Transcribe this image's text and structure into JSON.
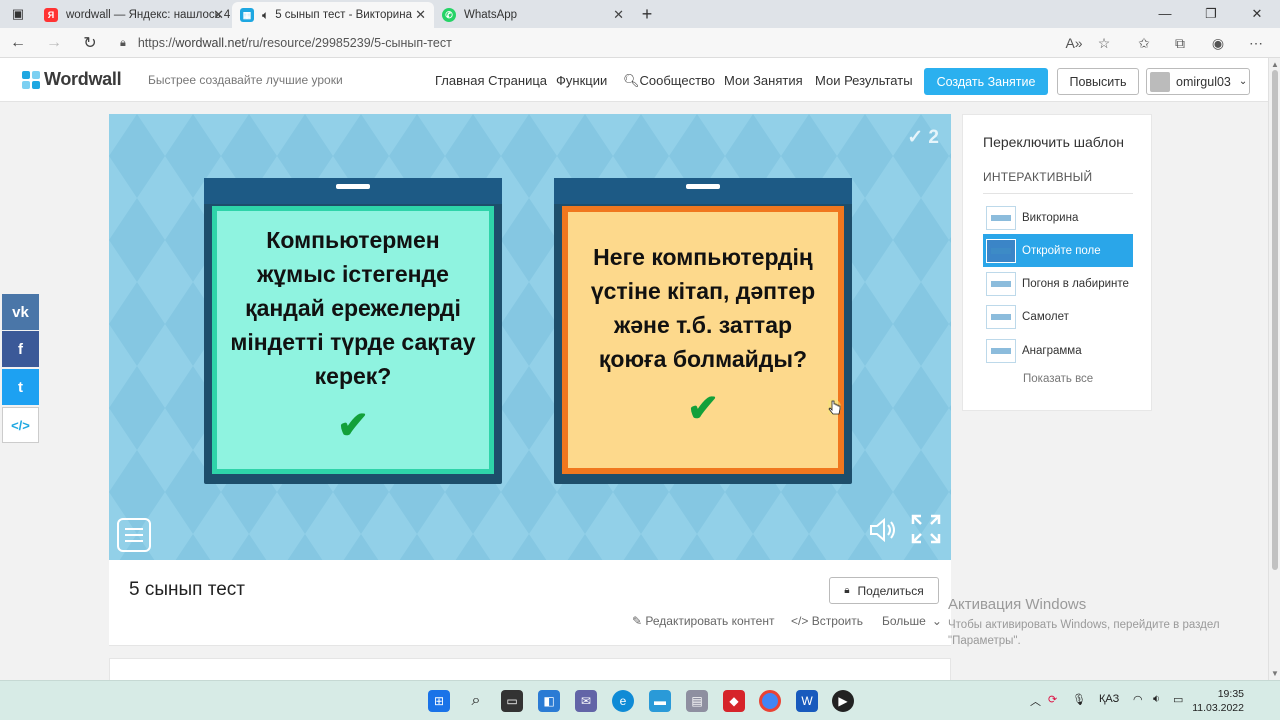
{
  "browser": {
    "tabs": [
      {
        "label": "wordwall — Яндекс: нашлось 4",
        "icon": "yandex-icon",
        "active": false
      },
      {
        "label": "5 сынып тест - Викторина",
        "icon": "wordwall-icon",
        "active": true
      },
      {
        "label": "WhatsApp",
        "icon": "whatsapp-icon",
        "active": false
      }
    ],
    "new_tab": "+",
    "url": {
      "scheme": "https://",
      "host": "wordwall.net",
      "path": "/ru/resource/29985239/5-сынып-тест"
    }
  },
  "site_header": {
    "logo_text": "Wordwall",
    "tagline": "Быстрее создавайте лучшие уроки",
    "nav": [
      "Главная Страница",
      "Функции",
      "Сообщество",
      "Мои Занятия",
      "Мои Результаты"
    ],
    "create_button": "Создать Занятие",
    "upgrade_button": "Повысить",
    "username": "omirgul03"
  },
  "game": {
    "counter": "2",
    "cards": [
      {
        "question": "Компьютермен жұмыс істегенде қандай ережелерді міндетті түрде сақтау керек?",
        "mark": "✔"
      },
      {
        "question": "Неге компьютердің үстіне кітап, дәптер және т.б. заттар қоюға болмайды?",
        "mark": "✔"
      }
    ]
  },
  "resource": {
    "title": "5 сынып тест",
    "share_button": "Поделиться",
    "edit_content": "Редактировать контент",
    "embed": "Встроить",
    "more": "Больше"
  },
  "template_panel": {
    "heading": "Переключить шаблон",
    "section": "ИНТЕРАКТИВНЫЙ",
    "templates": [
      "Викторина",
      "Откройте поле",
      "Погоня в лабиринте",
      "Самолет",
      "Анаграмма"
    ],
    "selected": "Откройте поле",
    "show_all": "Показать все"
  },
  "social": [
    {
      "label": "vk",
      "color": "#4a76a8"
    },
    {
      "label": "f",
      "color": "#3b5998"
    },
    {
      "label": "t",
      "color": "#1da1f2"
    },
    {
      "label": "</>",
      "color": "#ffffff"
    }
  ],
  "watermark": {
    "title": "Активация Windows",
    "body": "Чтобы активировать Windows, перейдите в раздел \"Параметры\"."
  },
  "taskbar": {
    "lang": "ҚАЗ",
    "time": "19:35",
    "date": "11.03.2022"
  }
}
